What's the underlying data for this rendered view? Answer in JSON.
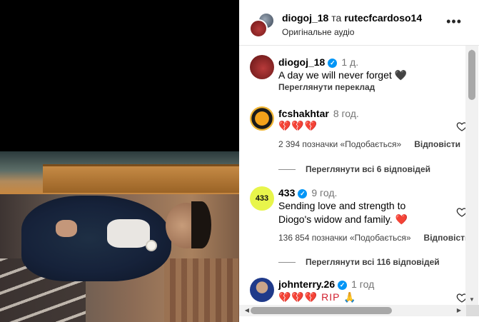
{
  "post": {
    "authors": {
      "user1": "diogoj_18",
      "joiner": "та",
      "user2": "rutecfcardoso14"
    },
    "audio": "Оригінальне аудіо"
  },
  "caption": {
    "username": "diogoj_18",
    "time": "1 д.",
    "text": "A day we will never forget 🖤",
    "translate": "Переглянути переклад"
  },
  "comments": [
    {
      "username": "fcshakhtar",
      "time": "8 год.",
      "text": "💔💔💔",
      "likes": "2 394 позначки «Подобається»",
      "reply": "Відповісти",
      "view_replies": "Переглянути всі 6 відповідей"
    },
    {
      "username": "433",
      "time": "9 год.",
      "text": "Sending love and strength to Diogo's widow and family. ❤️",
      "likes": "136 854 позначки «Подобається»",
      "reply": "Відповісти",
      "view_replies": "Переглянути всі 116 відповідей"
    },
    {
      "username": "johnterry.26",
      "time": "1 год",
      "text": "💔💔💔 RIP 🙏"
    }
  ],
  "icons": {
    "verified": "verified-badge-icon",
    "more": "more-options-icon",
    "like": "heart-outline-icon"
  },
  "colors": {
    "verified": "#0095f6",
    "heart": "#d11f2e",
    "secondary_text": "#737373"
  }
}
